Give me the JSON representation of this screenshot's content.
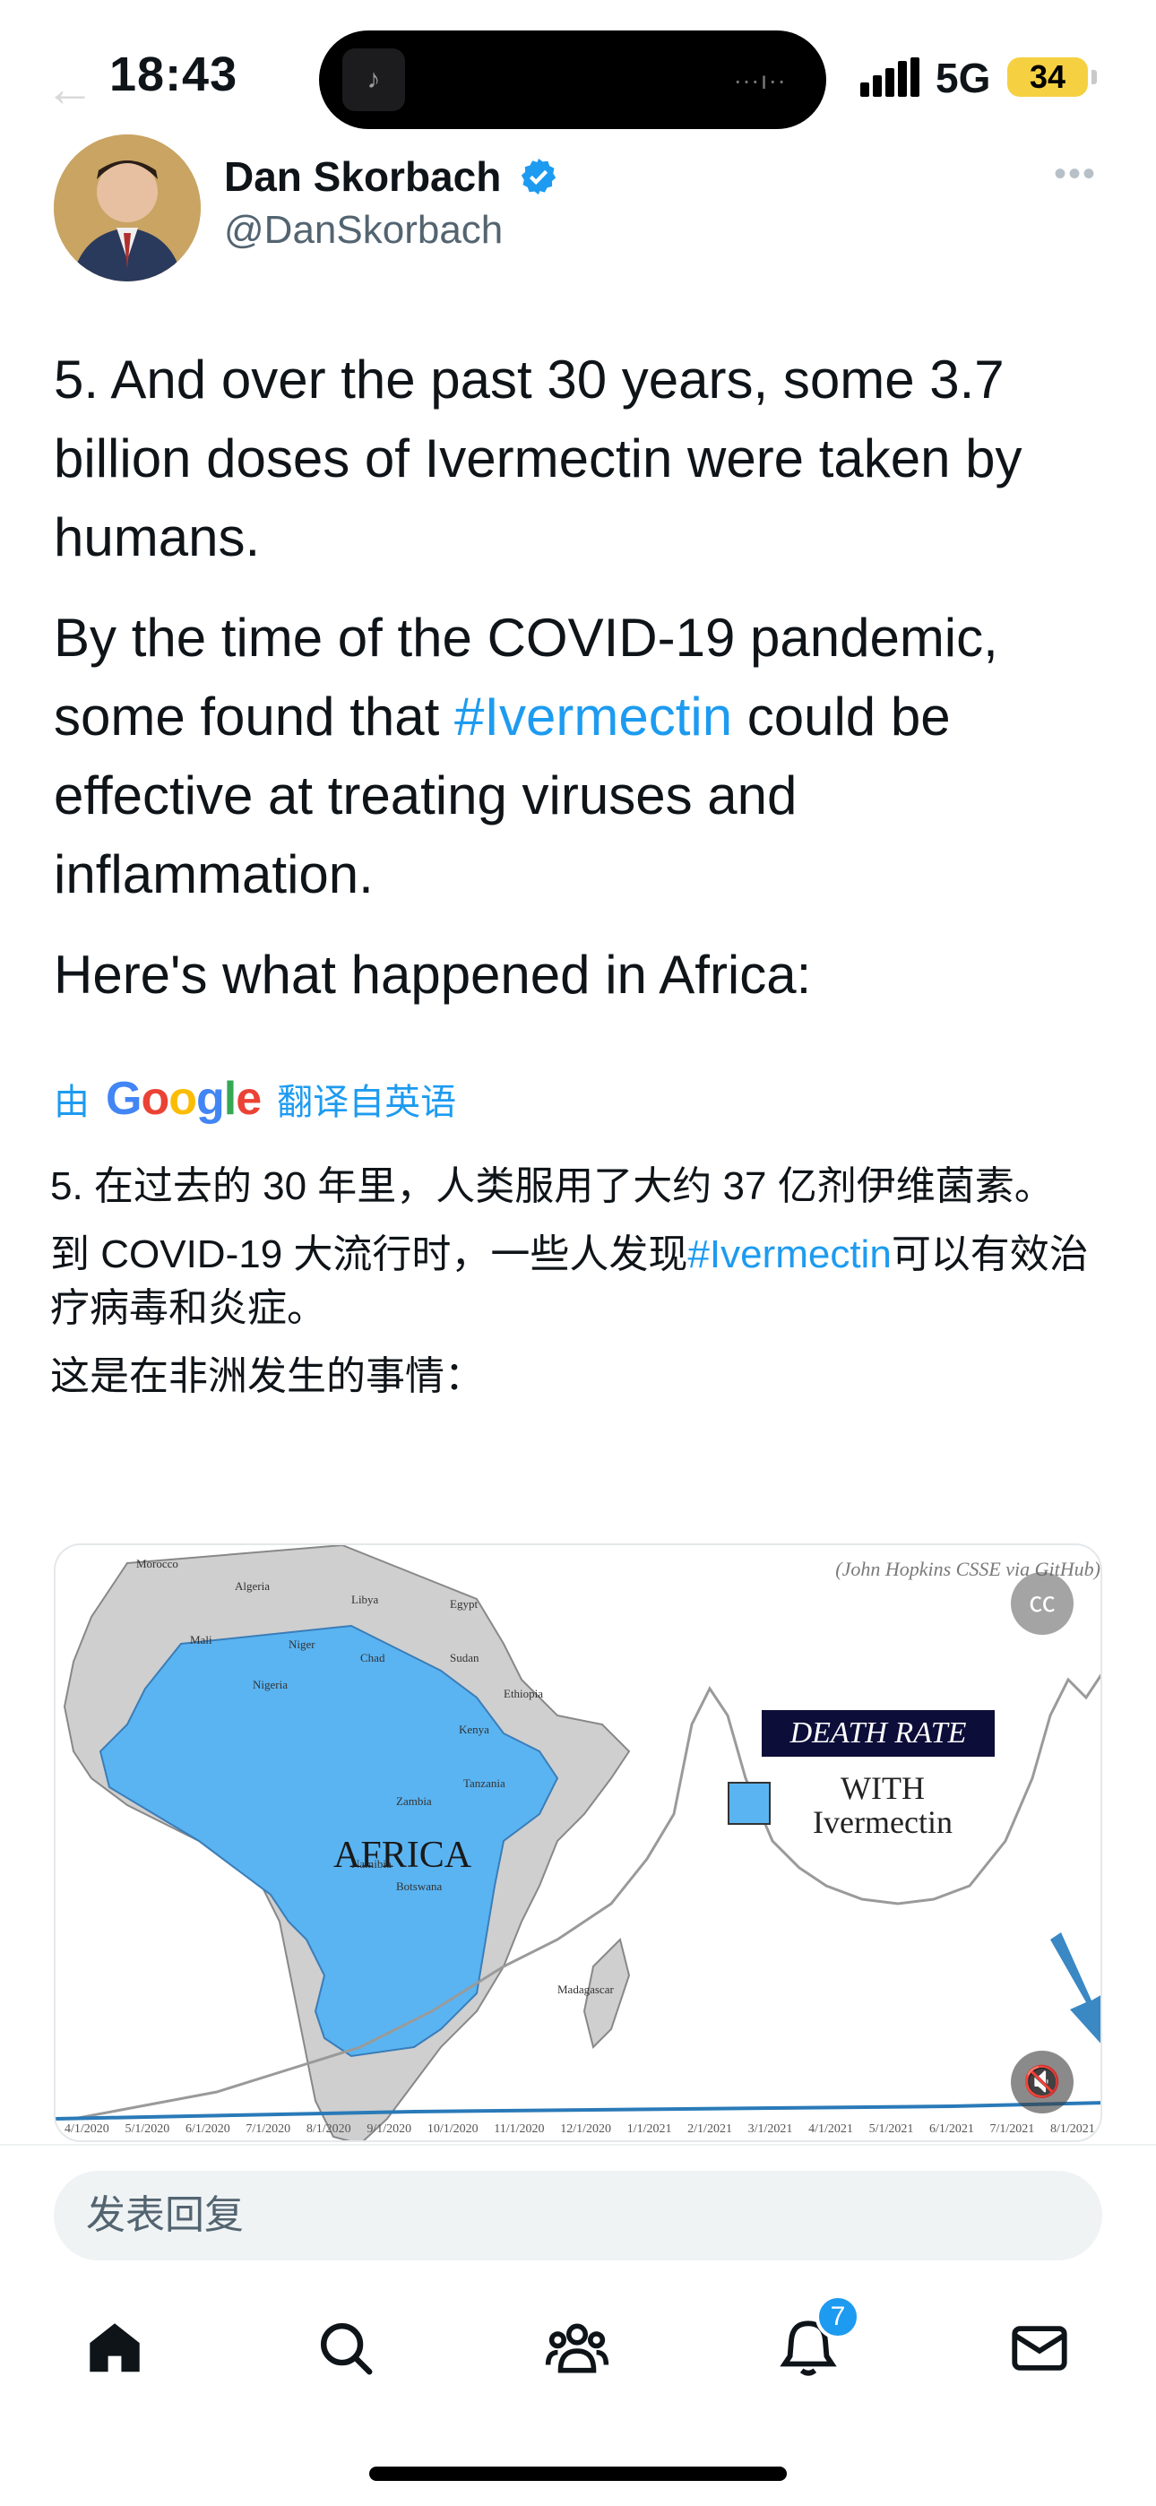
{
  "status_bar": {
    "time": "18:43",
    "network": "5G",
    "battery": "34",
    "island_icon": "music-note-icon"
  },
  "author": {
    "name": "Dan Skorbach",
    "handle": "@DanSkorbach",
    "verified_icon": "verified-badge-icon"
  },
  "tweet": {
    "para1": "5. And over the past 30 years, some 3.7 billion doses of Ivermectin were taken by humans.",
    "para2_before": "By the time of the COVID-19 pandemic, some found that ",
    "para2_hashtag": "#Ivermectin",
    "para2_after": " could be effective at treating viruses and inflammation.",
    "para3": "Here's what happened in Africa:"
  },
  "translation": {
    "prefix": "由",
    "google": "Google",
    "suffix": "翻译自英语",
    "para1": "5. 在过去的 30 年里，人类服用了大约 37 亿剂伊维菌素。",
    "para2_before": "到 COVID-19 大流行时，一些人发现",
    "para2_hashtag": "#Ivermectin",
    "para2_after": "可以有效治疗病毒和炎症。",
    "para3": "这是在非洲发生的事情："
  },
  "media": {
    "source": "(John Hopkins CSSE via GitHub)",
    "death_rate": "DEATH RATE",
    "legend_with": "WITH",
    "legend_ivermectin": "Ivermectin",
    "africa": "AFRICA",
    "dates": [
      "4/1/2020",
      "5/1/2020",
      "6/1/2020",
      "7/1/2020",
      "8/1/2020",
      "9/1/2020",
      "10/1/2020",
      "11/1/2020",
      "12/1/2020",
      "1/1/2021",
      "2/1/2021",
      "3/1/2021",
      "4/1/2021",
      "5/1/2021",
      "6/1/2021",
      "7/1/2021",
      "8/1/2021"
    ],
    "countries": [
      "Morocco",
      "Algeria",
      "Libya",
      "Egypt",
      "Mali",
      "Niger",
      "Chad",
      "Sudan",
      "Nigeria",
      "Ethiopia",
      "Kenya",
      "Tanzania",
      "Zambia",
      "Namibia",
      "Botswana",
      "Madagascar"
    ]
  },
  "reply": {
    "placeholder": "发表回复"
  },
  "tabbar": {
    "notifications_badge": "7"
  }
}
